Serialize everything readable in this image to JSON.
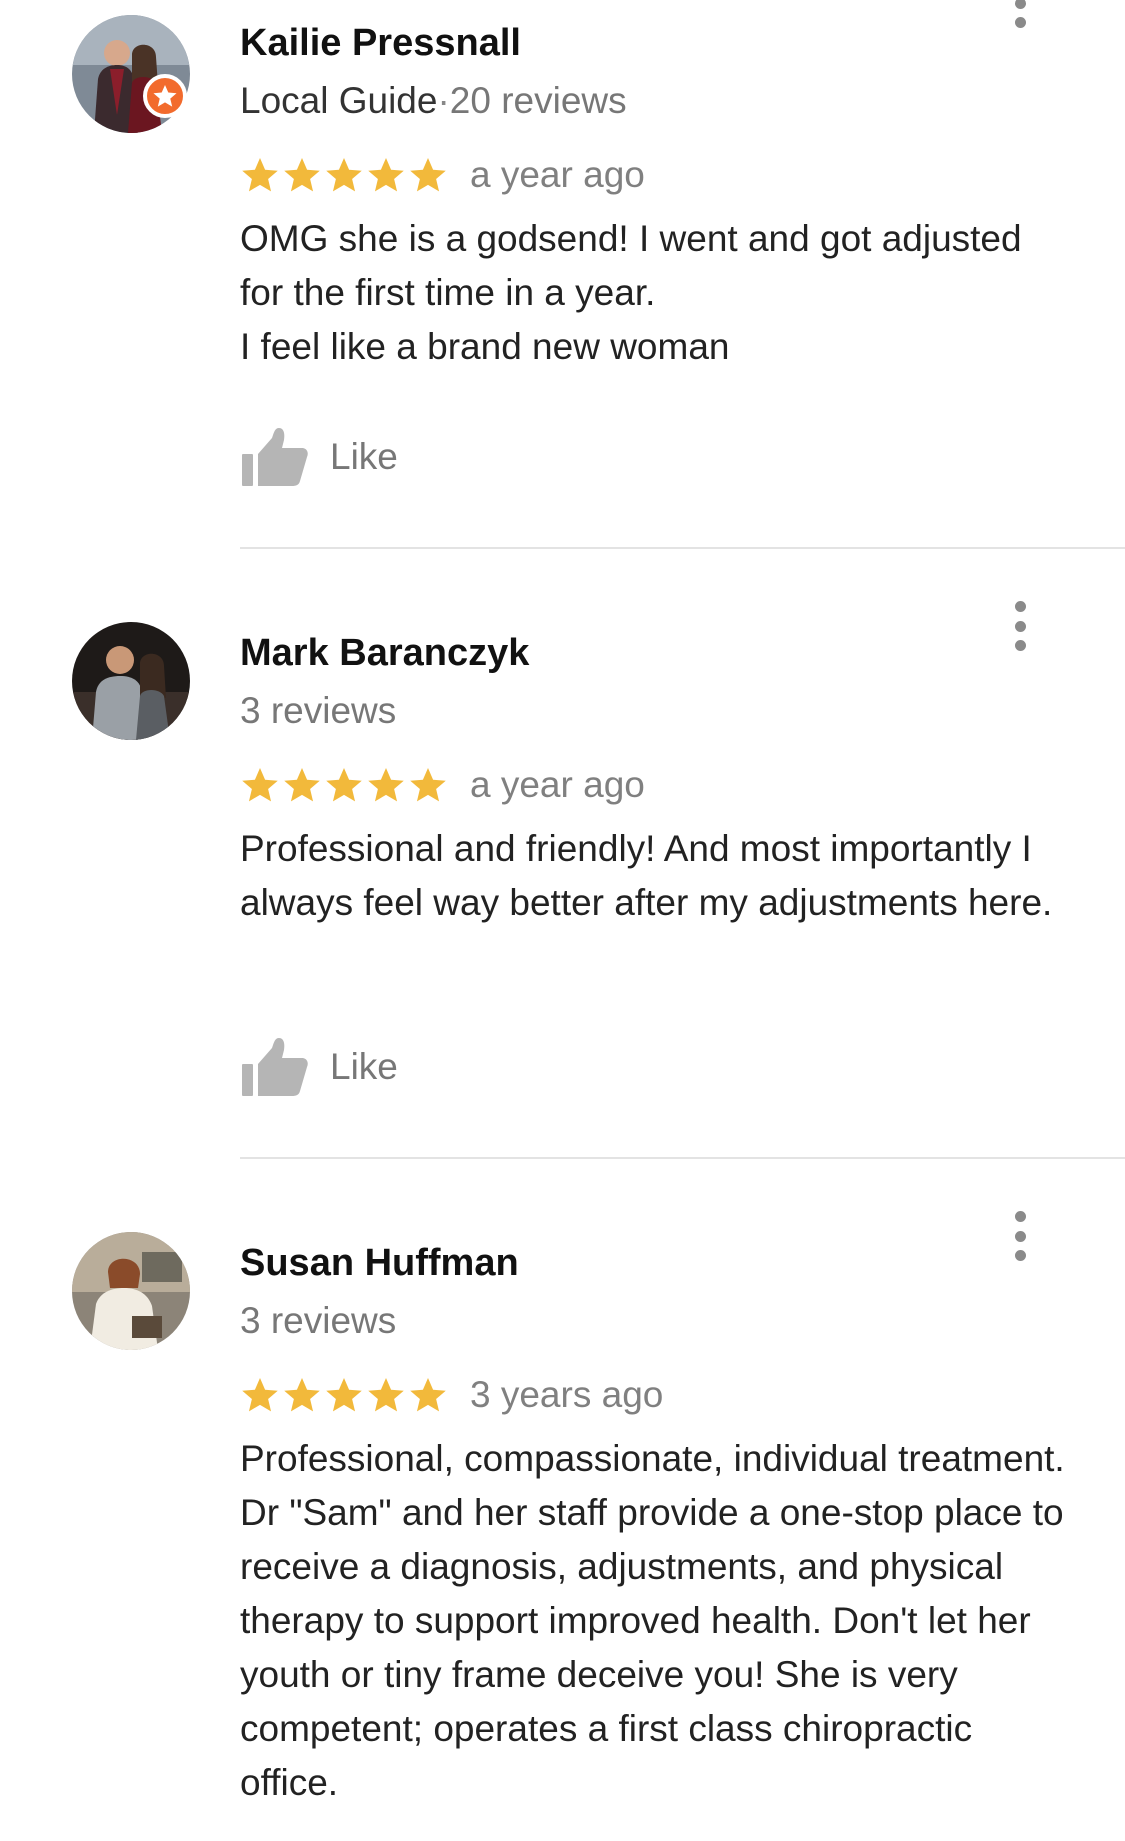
{
  "colors": {
    "star": "#F2B93B",
    "guide_badge": "#F26B2D",
    "muted_text": "#777777",
    "divider": "#E3E3E3"
  },
  "reviews": [
    {
      "name": "Kailie Pressnall",
      "local_guide_label": "Local Guide",
      "separator": "·",
      "reviews_count": "20 reviews",
      "rating": 5,
      "time": "a year ago",
      "text": "OMG she is a godsend! I went and got adjusted for the first time in a year.\nI feel like a brand new woman",
      "like_label": "Like",
      "avatar_icon": "user-photo-avatar",
      "badge_icon": "local-guide-star-icon"
    },
    {
      "name": "Mark Baranczyk",
      "reviews_count": "3 reviews",
      "rating": 5,
      "time": "a year ago",
      "text": "Professional and friendly!  And most importantly I always feel way better after my adjustments here.",
      "like_label": "Like",
      "avatar_icon": "user-photo-avatar"
    },
    {
      "name": "Susan Huffman",
      "reviews_count": "3 reviews",
      "rating": 5,
      "time": "3 years ago",
      "text": "Professional, compassionate, individual treatment. Dr \"Sam\" and her staff provide a one-stop place to receive a diagnosis, adjustments, and physical therapy to support improved health. Don't let her youth or tiny frame deceive you! She is very competent; operates a first class chiropractic office.",
      "avatar_icon": "user-photo-avatar"
    }
  ]
}
